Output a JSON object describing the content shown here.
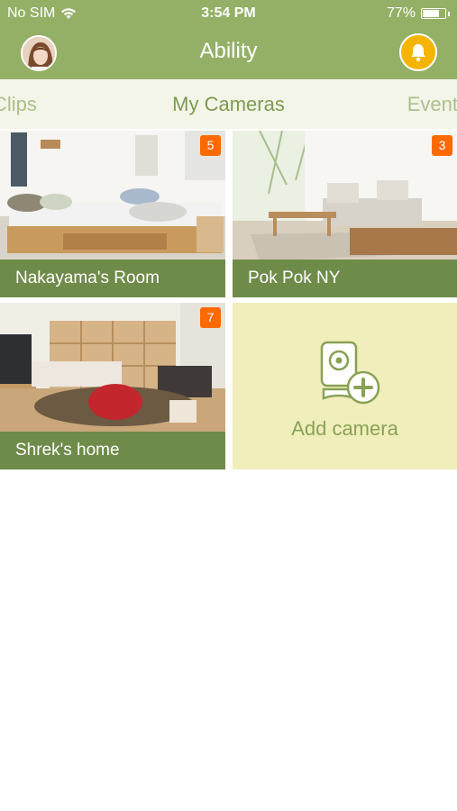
{
  "status_bar": {
    "carrier": "No SIM",
    "time": "3:54 PM",
    "battery": "77%",
    "battery_level": 0.77
  },
  "nav": {
    "title": "Ability",
    "avatar_icon": "user-avatar",
    "bell_icon": "bell-icon",
    "accent_color": "#94b066",
    "bell_color": "#f5b400"
  },
  "tabs": [
    {
      "label": "Clips"
    },
    {
      "label": "My Cameras"
    },
    {
      "label": "Events"
    }
  ],
  "cameras": [
    {
      "name": "Nakayama's Room",
      "badge": "5"
    },
    {
      "name": "Pok Pok NY",
      "badge": "3"
    },
    {
      "name": "Shrek's home",
      "badge": "7"
    }
  ],
  "add_camera": {
    "label": "Add camera",
    "icon": "camera-plus-icon"
  }
}
